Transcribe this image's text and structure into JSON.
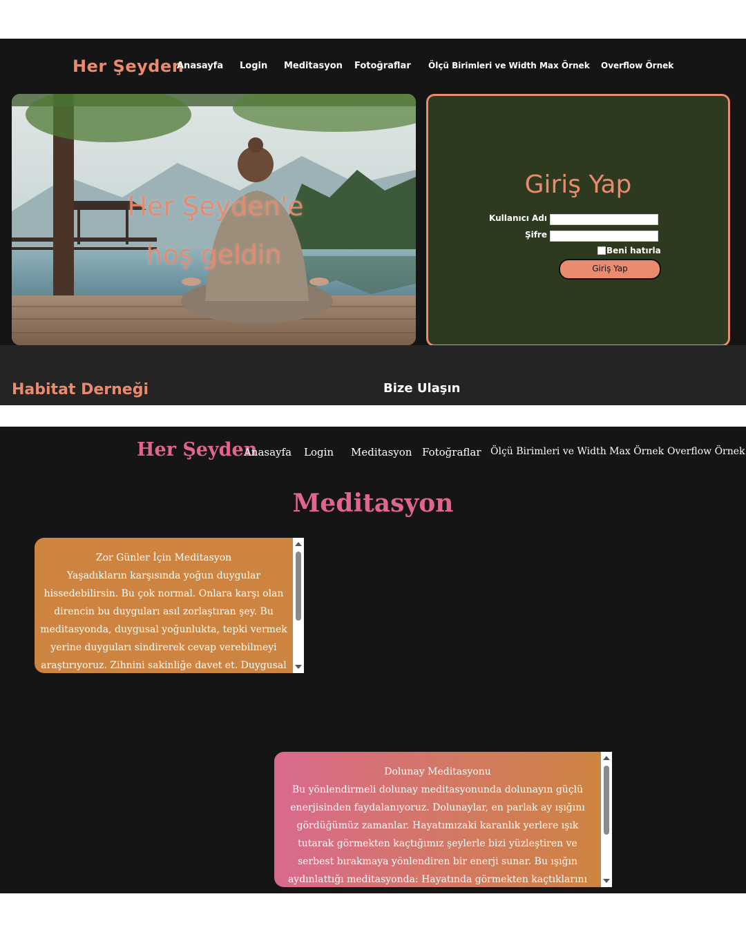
{
  "top": {
    "brand": "Her Şeyden",
    "nav": [
      "Anasayfa",
      "Login",
      "Meditasyon",
      "Fotoğraflar",
      "Ölçü Birimleri ve Width Max Örnek",
      "Overflow Örnek"
    ],
    "hero": {
      "line1": "Her Şeyden'e",
      "line2": "hoş geldin"
    },
    "login": {
      "title": "Giriş Yap",
      "username_label": "Kullanıcı Adı",
      "password_label": "Şifre",
      "remember_label": "Beni hatırla",
      "submit_label": "Giriş Yap"
    },
    "footer": {
      "brand": "Habitat Derneği",
      "contact": "Bize Ulaşın"
    }
  },
  "bottom": {
    "brand": "Her Şeyden",
    "nav": [
      "Anasayfa",
      "Login",
      "Meditasyon",
      "Fotoğraflar",
      "Ölçü Birimleri ve Width Max Örnek",
      "Overflow Örnek"
    ],
    "page_title": "Meditasyon",
    "cards": [
      {
        "title": "Zor Günler İçin Meditasyon",
        "body": "Yaşadıkların karşısında yoğun duygular hissedebilirsin. Bu çok normal. Onlara karşı olan direncin bu duyguları asıl zorlaştıran şey. Bu meditasyonda, duygusal yoğunlukta, tepki vermek yerine duyguları sindirerek cevap verebilmeyi araştırıyoruz. Zihnini sakinliğe davet et. Duygusal dengeyi koruyarak içsel huzuru güçlendir. Duygularını derinden"
      },
      {
        "title": "Dolunay Meditasyonu",
        "body": "Bu yönlendirmeli dolunay meditasyonunda dolunayın güçlü enerjisinden faydalanıyoruz. Dolunaylar, en parlak ay ışığını gördüğümüz zamanlar. Hayatımızaki karanlık yerlere ışık tutarak görmekten kaçtığımız şeylerle bizi yüzleştiren ve serbest bırakmaya yönlendiren bir enerji sunar. Bu ışığın aydınlattığı meditasyonda: Hayatında görmekten kaçtıklarını fark et Sana hizmet etmeyen şeyleri"
      }
    ]
  },
  "colors": {
    "accent_orange": "#ec8a6d",
    "accent_pink": "#e0668f",
    "login_panel": "#2e3a1f",
    "background": "#151515"
  }
}
